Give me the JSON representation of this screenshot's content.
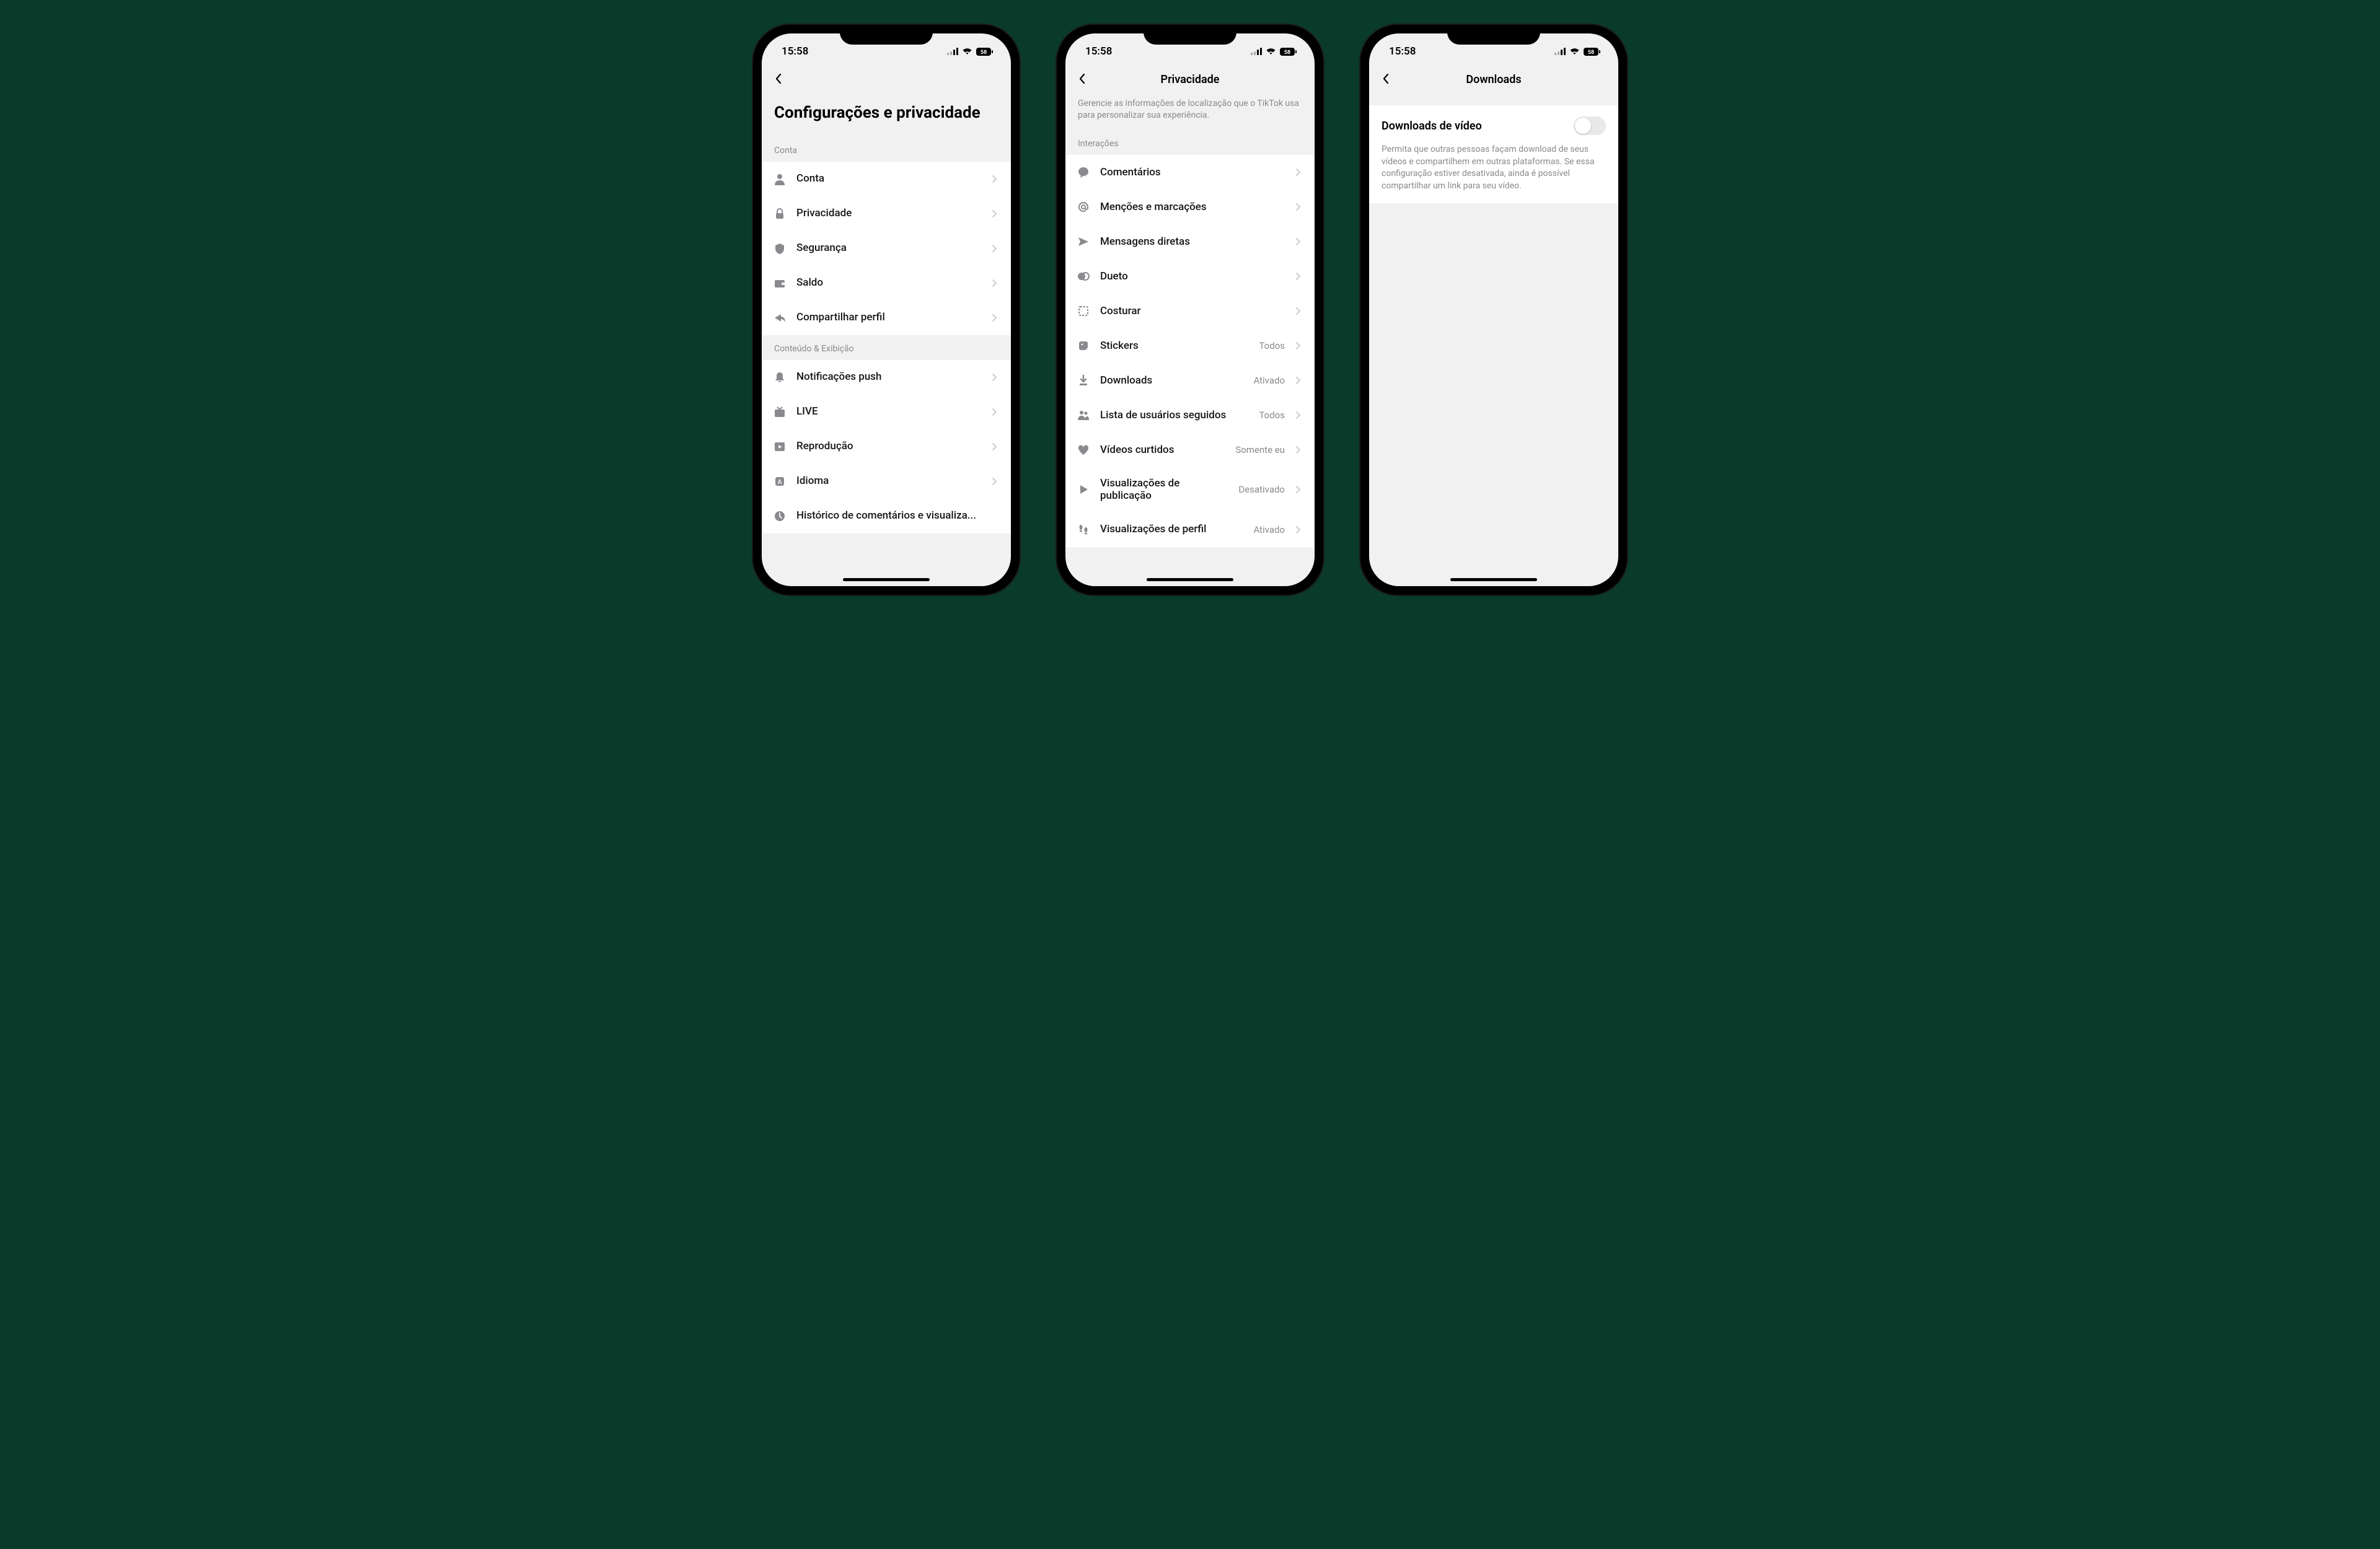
{
  "status": {
    "time": "15:58",
    "battery": "58"
  },
  "screen1": {
    "title": "Configurações e privacidade",
    "sections": [
      {
        "header": "Conta",
        "items": [
          {
            "label": "Conta"
          },
          {
            "label": "Privacidade"
          },
          {
            "label": "Segurança"
          },
          {
            "label": "Saldo"
          },
          {
            "label": "Compartilhar perfil"
          }
        ]
      },
      {
        "header": "Conteúdo & Exibição",
        "items": [
          {
            "label": "Notificações push"
          },
          {
            "label": "LIVE"
          },
          {
            "label": "Reprodução"
          },
          {
            "label": "Idioma"
          },
          {
            "label": "Histórico de comentários e visualiza..."
          }
        ]
      }
    ]
  },
  "screen2": {
    "title": "Privacidade",
    "info": "Gerencie as informações de localização que o TikTok usa para personalizar sua experiência.",
    "section_header": "Interações",
    "items": [
      {
        "label": "Comentários",
        "value": ""
      },
      {
        "label": "Menções e marcações",
        "value": ""
      },
      {
        "label": "Mensagens diretas",
        "value": ""
      },
      {
        "label": "Dueto",
        "value": ""
      },
      {
        "label": "Costurar",
        "value": ""
      },
      {
        "label": "Stickers",
        "value": "Todos"
      },
      {
        "label": "Downloads",
        "value": "Ativado"
      },
      {
        "label": "Lista de usuários seguidos",
        "value": "Todos"
      },
      {
        "label": "Vídeos curtidos",
        "value": "Somente eu"
      },
      {
        "label": "Visualizações de publicação",
        "value": "Desativado"
      },
      {
        "label": "Visualizações de perfil",
        "value": "Ativado"
      }
    ]
  },
  "screen3": {
    "title": "Downloads",
    "toggle_label": "Downloads de vídeo",
    "toggle_on": false,
    "desc": "Permita que outras pessoas façam download de seus vídeos e compartilhem em outras plataformas. Se essa configuração estiver desativada, ainda é possível compartilhar um link para seu vídeo."
  }
}
